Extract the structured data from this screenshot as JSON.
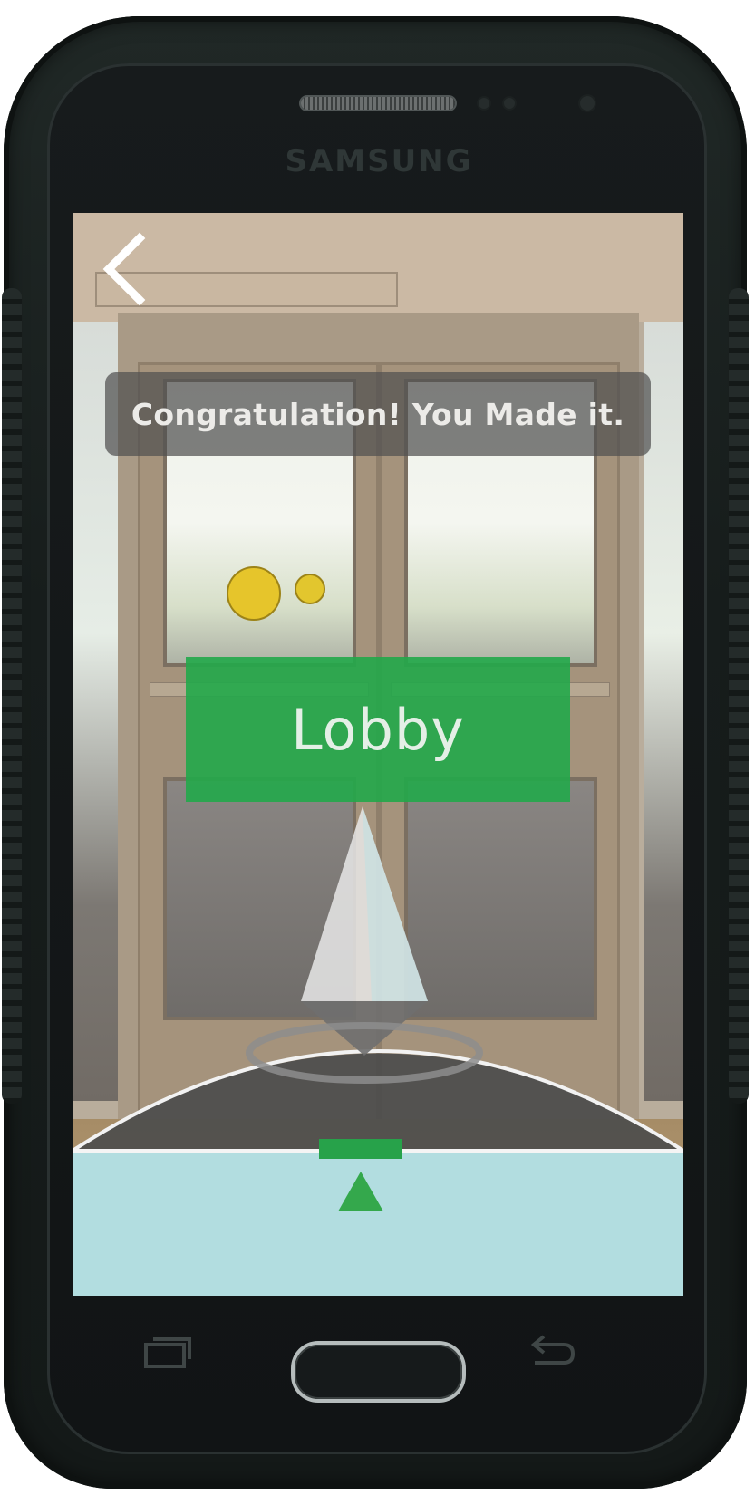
{
  "device": {
    "brand": "SAMSUNG"
  },
  "screen": {
    "back_icon": "chevron-left-icon",
    "message": "Congratulation! You Made it.",
    "destination_label": "Lobby",
    "direction_indicator_icon": "up-arrow-icon"
  },
  "colors": {
    "accent_green": "#22a84a",
    "banner_bg": "#505050",
    "radar_bg": "#b2dde0"
  },
  "nav_keys": {
    "recent_icon": "recent-apps-icon",
    "home": "home-button",
    "back_icon": "back-arrow-icon"
  }
}
